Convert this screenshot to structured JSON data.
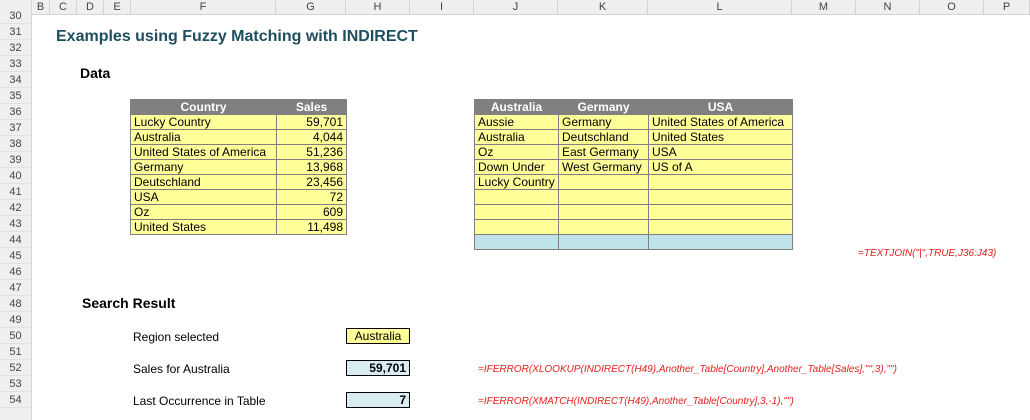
{
  "columns": [
    "B",
    "C",
    "D",
    "E",
    "F",
    "G",
    "H",
    "I",
    "J",
    "K",
    "L",
    "M",
    "N",
    "O",
    "P"
  ],
  "rows": [
    "30",
    "31",
    "32",
    "33",
    "34",
    "35",
    "36",
    "37",
    "38",
    "39",
    "40",
    "41",
    "42",
    "43",
    "44",
    "45",
    "46",
    "47",
    "48",
    "49",
    "50",
    "51",
    "52",
    "53",
    "54"
  ],
  "title": "Examples using Fuzzy Matching with INDIRECT",
  "data_heading": "Data",
  "sales_table": {
    "headers": [
      "Country",
      "Sales"
    ],
    "rows": [
      [
        "Lucky Country",
        "59,701"
      ],
      [
        "Australia",
        "4,044"
      ],
      [
        "United States of America",
        "51,236"
      ],
      [
        "Germany",
        "13,968"
      ],
      [
        "Deutschland",
        "23,456"
      ],
      [
        "USA",
        "72"
      ],
      [
        "Oz",
        "609"
      ],
      [
        "United States",
        "11,498"
      ]
    ]
  },
  "alias_table": {
    "headers": [
      "Australia",
      "Germany",
      "USA"
    ],
    "rows": [
      [
        "Aussie",
        "Germany",
        "United States of America"
      ],
      [
        "Australia",
        "Deutschland",
        "United States"
      ],
      [
        "Oz",
        "East Germany",
        "USA"
      ],
      [
        "Down Under",
        "West Germany",
        "US of A"
      ],
      [
        "Lucky Country",
        "",
        ""
      ],
      [
        "",
        "",
        ""
      ],
      [
        "",
        "",
        ""
      ],
      [
        "",
        "",
        ""
      ]
    ]
  },
  "formula_textjoin": "=TEXTJOIN(\"|\",TRUE,J36:J43)",
  "search_heading": "Search Result",
  "region_label": "Region selected",
  "region_value": "Australia",
  "sales_label": "Sales for Australia",
  "sales_value": "59,701",
  "formula_sales": "=IFERROR(XLOOKUP(INDIRECT(H49),Another_Table[Country],Another_Table[Sales],\"\",3),\"\")",
  "last_label": "Last Occurrence in Table",
  "last_value": "7",
  "formula_last": "=IFERROR(XMATCH(INDIRECT(H49),Another_Table[Country],3,-1),\"\")"
}
